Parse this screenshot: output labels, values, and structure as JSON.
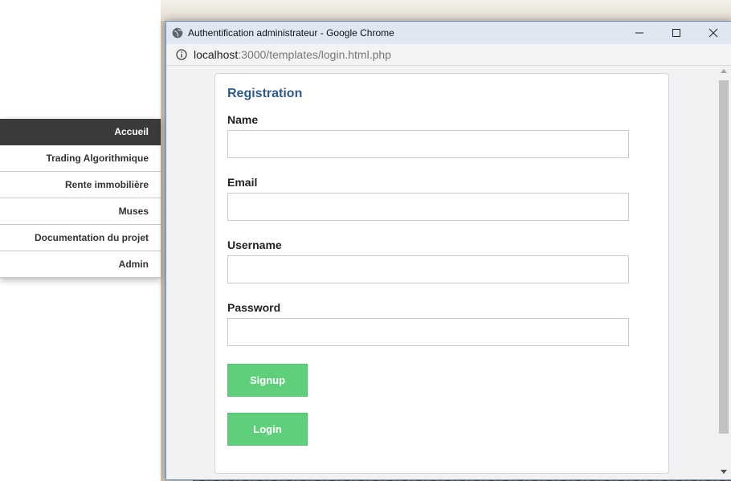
{
  "sidebar": {
    "items": [
      {
        "label": "Accueil",
        "active": true
      },
      {
        "label": "Trading Algorithmique",
        "active": false
      },
      {
        "label": "Rente immobilière",
        "active": false
      },
      {
        "label": "Muses",
        "active": false
      },
      {
        "label": "Documentation du projet",
        "active": false
      },
      {
        "label": "Admin",
        "active": false
      }
    ]
  },
  "popup": {
    "window_title": "Authentification administrateur - Google Chrome",
    "url_host": "localhost",
    "url_path": ":3000/templates/login.html.php",
    "icons": [
      "globe-icon",
      "info-icon",
      "minimize-icon",
      "maximize-icon",
      "close-icon"
    ],
    "form": {
      "title": "Registration",
      "fields": [
        {
          "label": "Name",
          "value": ""
        },
        {
          "label": "Email",
          "value": ""
        },
        {
          "label": "Username",
          "value": ""
        },
        {
          "label": "Password",
          "value": ""
        }
      ],
      "signup_label": "Signup",
      "login_label": "Login"
    }
  },
  "colors": {
    "accent_button": "#5fcf7c",
    "title_blue": "#2d5b8c",
    "active_menu": "#3a3a3a"
  }
}
